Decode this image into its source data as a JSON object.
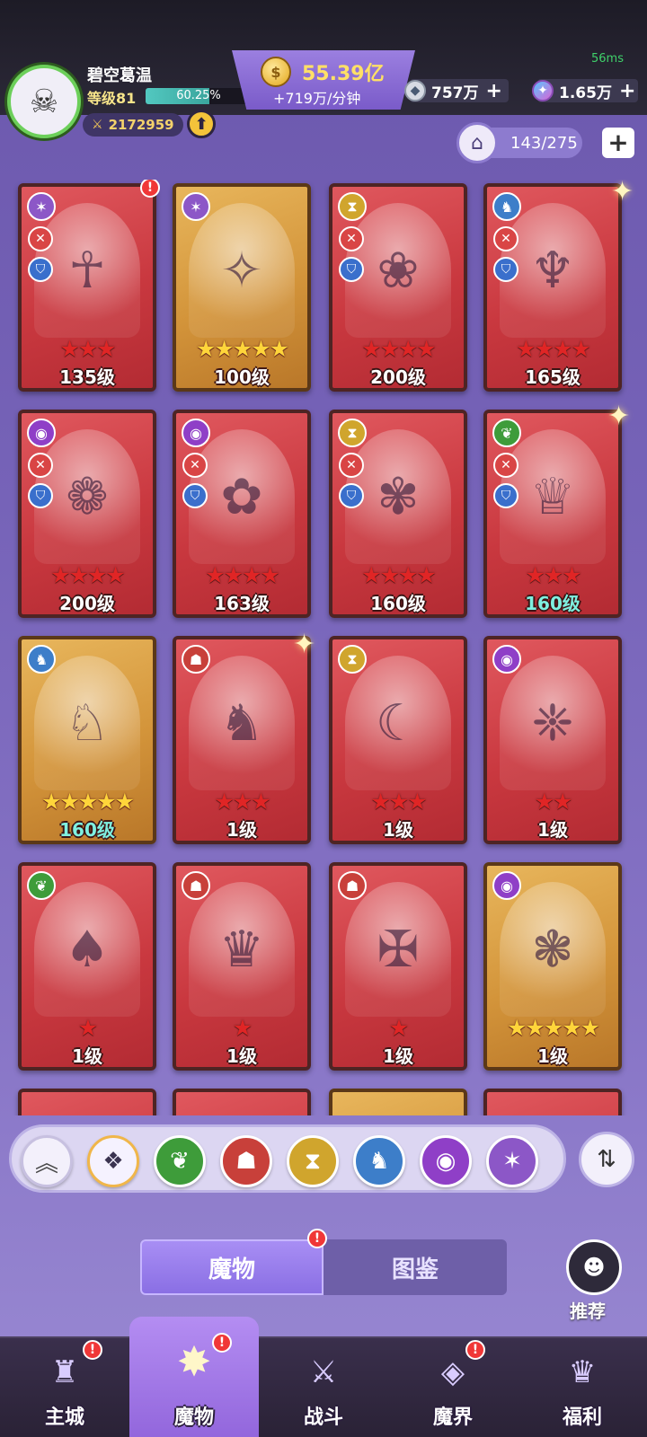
{
  "hud": {
    "ping": "56ms",
    "player_name": "碧空葛温",
    "level_label": "等级81",
    "exp_percent_text": "60.25%",
    "exp_fraction": 0.6025,
    "power": "2172959",
    "gold_amount": "55.39亿",
    "gold_rate": "+719万/分钟",
    "resource_1": "757万",
    "resource_2": "1.65万",
    "collection_count": "143/275"
  },
  "cards": [
    {
      "level": "135级",
      "stars": 3,
      "star_color": "red",
      "frame": "red",
      "element": "wind",
      "alert": true
    },
    {
      "level": "100级",
      "stars": 5,
      "star_color": "gold",
      "frame": "gold",
      "element": "wind",
      "alert": false
    },
    {
      "level": "200级",
      "stars": 4,
      "star_color": "red",
      "frame": "red",
      "element": "hourglass",
      "alert": false
    },
    {
      "level": "165级",
      "stars": 4,
      "star_color": "red",
      "frame": "red",
      "element": "wolf",
      "alert": false
    },
    {
      "level": "200级",
      "stars": 4,
      "star_color": "red",
      "frame": "red",
      "element": "eye",
      "alert": false
    },
    {
      "level": "163级",
      "stars": 4,
      "star_color": "red",
      "frame": "red",
      "element": "eye",
      "alert": false
    },
    {
      "level": "160级",
      "stars": 4,
      "star_color": "red",
      "frame": "red",
      "element": "hourglass",
      "alert": false
    },
    {
      "level": "160级",
      "stars": 3,
      "star_color": "red",
      "frame": "red",
      "element": "leaf",
      "alert": false,
      "teal_level": true
    },
    {
      "level": "160级",
      "stars": 5,
      "star_color": "gold",
      "frame": "gold",
      "element": "wolf",
      "alert": false,
      "teal_level": true
    },
    {
      "level": "1级",
      "stars": 3,
      "star_color": "red",
      "frame": "red",
      "element": "demon",
      "alert": false
    },
    {
      "level": "1级",
      "stars": 3,
      "star_color": "red",
      "frame": "red",
      "element": "hourglass",
      "alert": false
    },
    {
      "level": "1级",
      "stars": 2,
      "star_color": "red",
      "frame": "red",
      "element": "eye",
      "alert": false
    },
    {
      "level": "1级",
      "stars": 1,
      "star_color": "red",
      "frame": "red",
      "element": "leaf",
      "alert": false
    },
    {
      "level": "1级",
      "stars": 1,
      "star_color": "red",
      "frame": "red",
      "element": "demon",
      "alert": false
    },
    {
      "level": "1级",
      "stars": 1,
      "star_color": "red",
      "frame": "red",
      "element": "demon",
      "alert": false
    },
    {
      "level": "1级",
      "stars": 5,
      "star_color": "gold",
      "frame": "gold",
      "element": "eye",
      "alert": false
    }
  ],
  "filters": [
    {
      "name": "collapse-filter",
      "icon": "double-chevron-up"
    },
    {
      "name": "filter-all",
      "icon": "diamond-grid"
    },
    {
      "name": "filter-leaf",
      "icon": "leaf"
    },
    {
      "name": "filter-demon",
      "icon": "demon-mask"
    },
    {
      "name": "filter-hourglass",
      "icon": "hourglass"
    },
    {
      "name": "filter-wolf",
      "icon": "wolf"
    },
    {
      "name": "filter-eye",
      "icon": "eye"
    },
    {
      "name": "filter-wind",
      "icon": "wind"
    }
  ],
  "tabs": {
    "monster": "魔物",
    "codex": "图鉴"
  },
  "recommend_label": "推荐",
  "nav": {
    "main_city": "主城",
    "monster": "魔物",
    "battle": "战斗",
    "demon_realm": "魔界",
    "welfare": "福利"
  },
  "colors": {
    "background": "#7663b8",
    "card_red": "#c9383f",
    "card_gold": "#d3943a",
    "alert": "#f03737",
    "gold_text": "#ffe066"
  }
}
